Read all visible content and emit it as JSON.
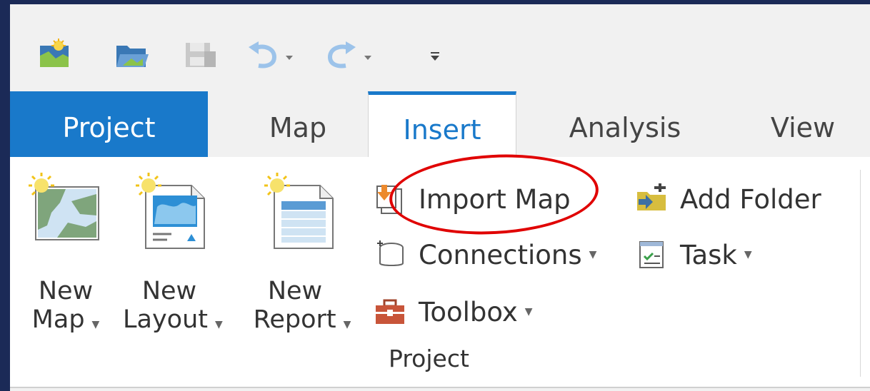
{
  "colors": {
    "accent": "#1979ca",
    "highlight": "#e00000",
    "background_outer": "#1b2a57"
  },
  "quick_access": [
    {
      "name": "new-project-icon"
    },
    {
      "name": "open-project-icon"
    },
    {
      "name": "save-project-icon"
    },
    {
      "name": "undo-icon"
    },
    {
      "name": "redo-icon"
    },
    {
      "name": "customize-toolbar-icon"
    }
  ],
  "tabs": [
    {
      "label": "Project"
    },
    {
      "label": "Map"
    },
    {
      "label": "Insert",
      "active": true
    },
    {
      "label": "Analysis"
    },
    {
      "label": "View"
    }
  ],
  "ribbon": {
    "big_buttons": [
      {
        "line1": "New",
        "line2": "Map",
        "icon": "new-map-icon"
      },
      {
        "line1": "New",
        "line2": "Layout",
        "icon": "new-layout-icon"
      },
      {
        "line1": "New",
        "line2": "Report",
        "icon": "new-report-icon"
      }
    ],
    "small_buttons": {
      "import_map": "Import Map",
      "connections": "Connections",
      "toolbox": "Toolbox",
      "add_folder": "Add Folder",
      "task": "Task"
    },
    "group_label": "Project"
  }
}
